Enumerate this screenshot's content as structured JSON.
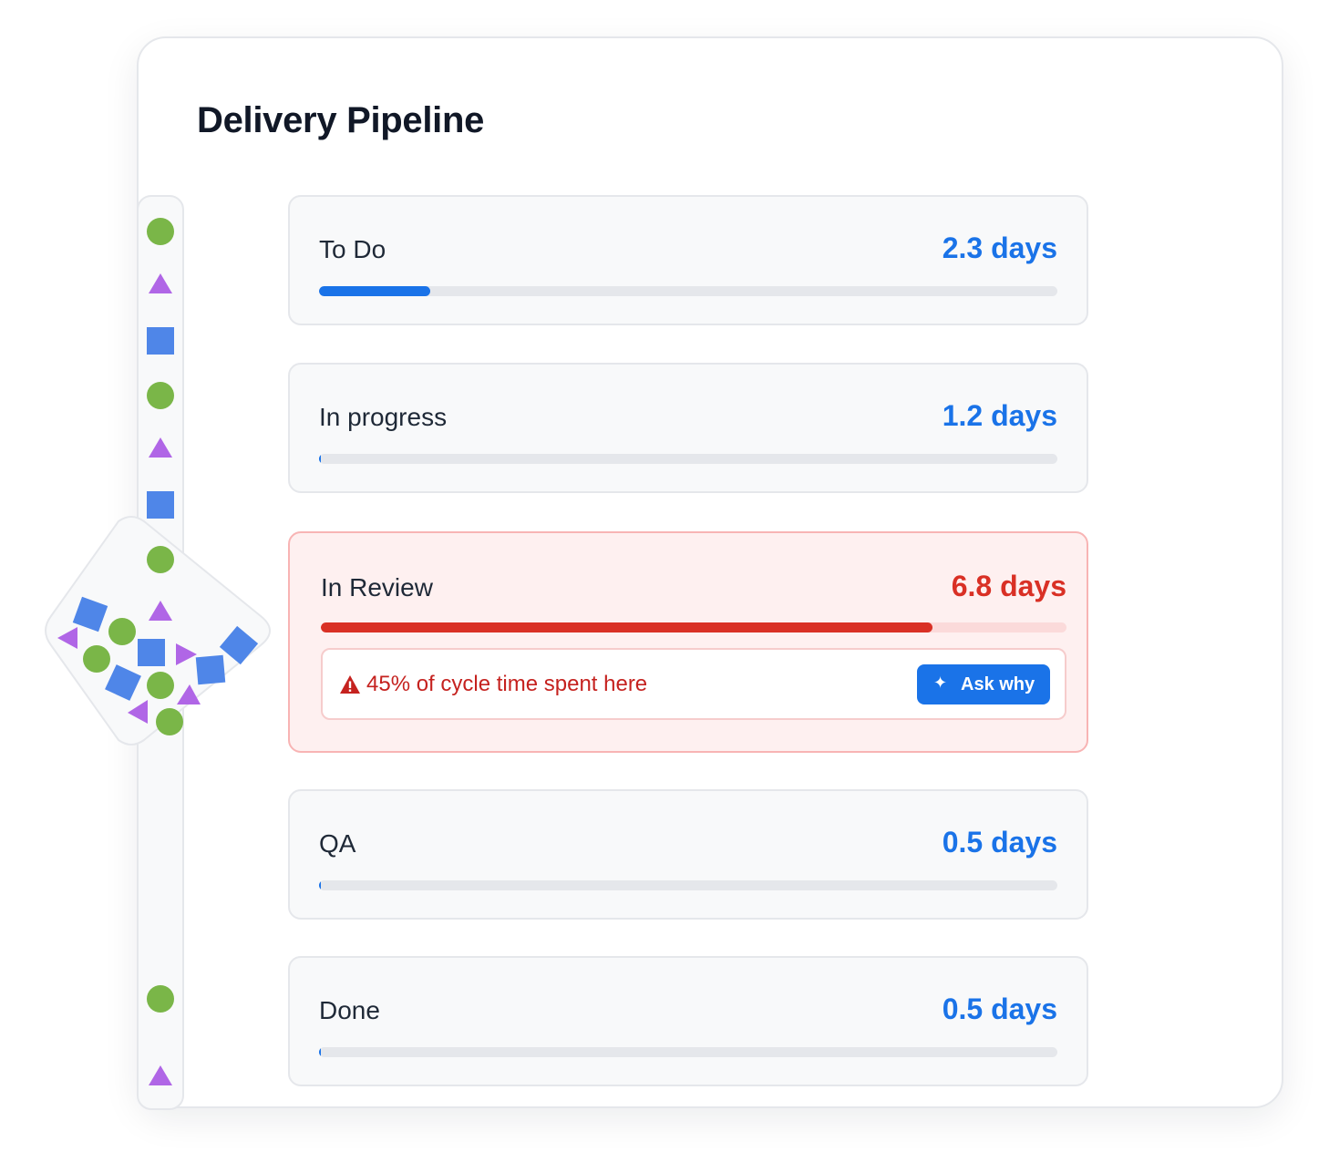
{
  "page": {
    "title": "Delivery Pipeline"
  },
  "colors": {
    "accent": "#1a73e8",
    "alert": "#d93025",
    "shape_circle": "#7ab648",
    "shape_square": "#4f86e8",
    "shape_triangle": "#b066e6"
  },
  "stages": [
    {
      "label": "To Do",
      "value": "2.3 days",
      "progress": 0.15
    },
    {
      "label": "In progress",
      "value": "1.2 days",
      "progress": 0.0
    },
    {
      "label": "In Review",
      "value": "6.8 days",
      "progress": 0.82,
      "alert": {
        "icon": "warning-icon",
        "message": "45% of cycle time spent here",
        "action": {
          "icon": "sparkle-icon",
          "label": "Ask why"
        }
      }
    },
    {
      "label": "QA",
      "value": "0.5 days",
      "progress": 0.0
    },
    {
      "label": "Done",
      "value": "0.5 days",
      "progress": 0.0
    }
  ],
  "flow_icons": [
    "circle-icon",
    "triangle-icon",
    "square-icon"
  ]
}
